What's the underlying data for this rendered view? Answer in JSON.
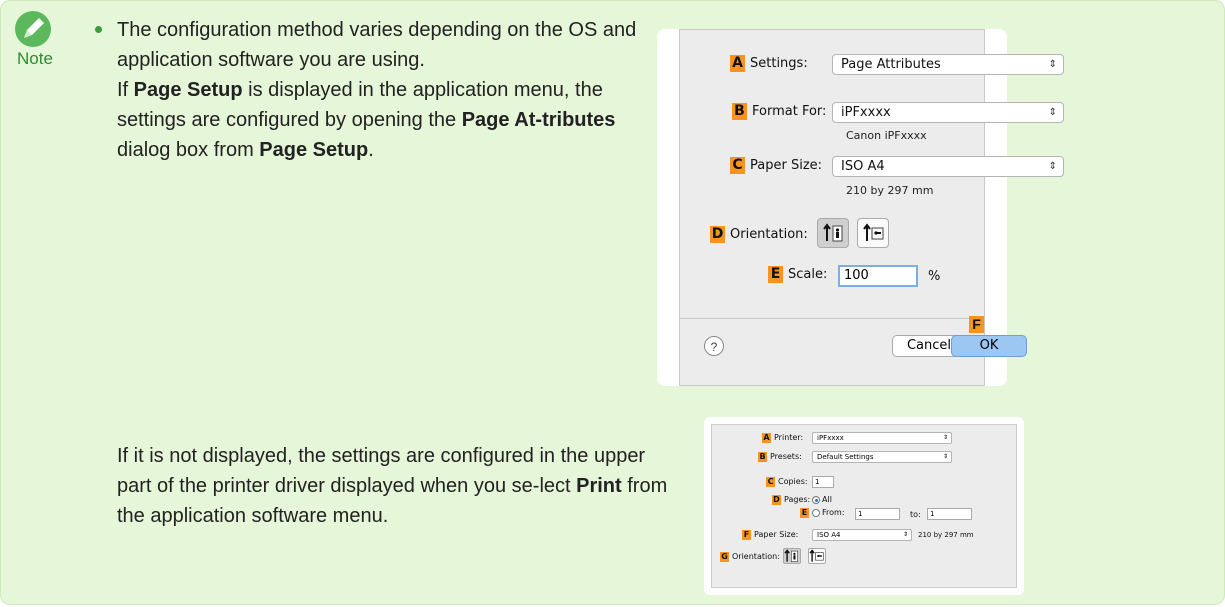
{
  "note": {
    "label": "Note",
    "bullet_text_1": "The configuration method varies depending on the OS and application software you are using.",
    "para1_a": "If ",
    "para1_b": "Page Setup",
    "para1_c": " is displayed in the application menu, the settings are configured by opening the ",
    "para1_d": "Page At-tributes",
    "para1_e": " dialog box from ",
    "para1_f": "Page Setup",
    "para1_g": ".",
    "para2_a": "If it is not displayed, the settings are configured in the upper part of the printer driver displayed when you se-lect ",
    "para2_b": "Print",
    "para2_c": " from the application software menu."
  },
  "page_attributes_dialog": {
    "settings": {
      "tag": "A",
      "label": "Settings:",
      "value": "Page Attributes"
    },
    "format_for": {
      "tag": "B",
      "label": "Format For:",
      "value": "iPFxxxx",
      "sub": "Canon iPFxxxx"
    },
    "paper_size": {
      "tag": "C",
      "label": "Paper Size:",
      "value": "ISO A4",
      "sub": "210 by 297 mm"
    },
    "orientation": {
      "tag": "D",
      "label": "Orientation:",
      "selected": "portrait"
    },
    "scale": {
      "tag": "E",
      "label": "Scale:",
      "value": "100",
      "unit": "%"
    },
    "help": "?",
    "ok_tag": "F",
    "cancel": "Cancel",
    "ok": "OK"
  },
  "print_dialog": {
    "printer": {
      "tag": "A",
      "label": "Printer:",
      "value": "iPFxxxx"
    },
    "presets": {
      "tag": "B",
      "label": "Presets:",
      "value": "Default Settings"
    },
    "copies": {
      "tag": "C",
      "label": "Copies:",
      "value": "1"
    },
    "pages": {
      "tag": "D",
      "label": "Pages:",
      "all": "All"
    },
    "from": {
      "tag": "E",
      "label": "From:",
      "from_value": "1",
      "to_label": "to:",
      "to_value": "1"
    },
    "paper_size": {
      "tag": "F",
      "label": "Paper Size:",
      "value": "ISO A4",
      "sub": "210 by 297 mm"
    },
    "orientation": {
      "tag": "G",
      "label": "Orientation:",
      "selected": "portrait"
    }
  },
  "colors": {
    "note_bg": "#e6f6d9",
    "tag": "#f7941d",
    "note_green": "#2e8b2e"
  }
}
